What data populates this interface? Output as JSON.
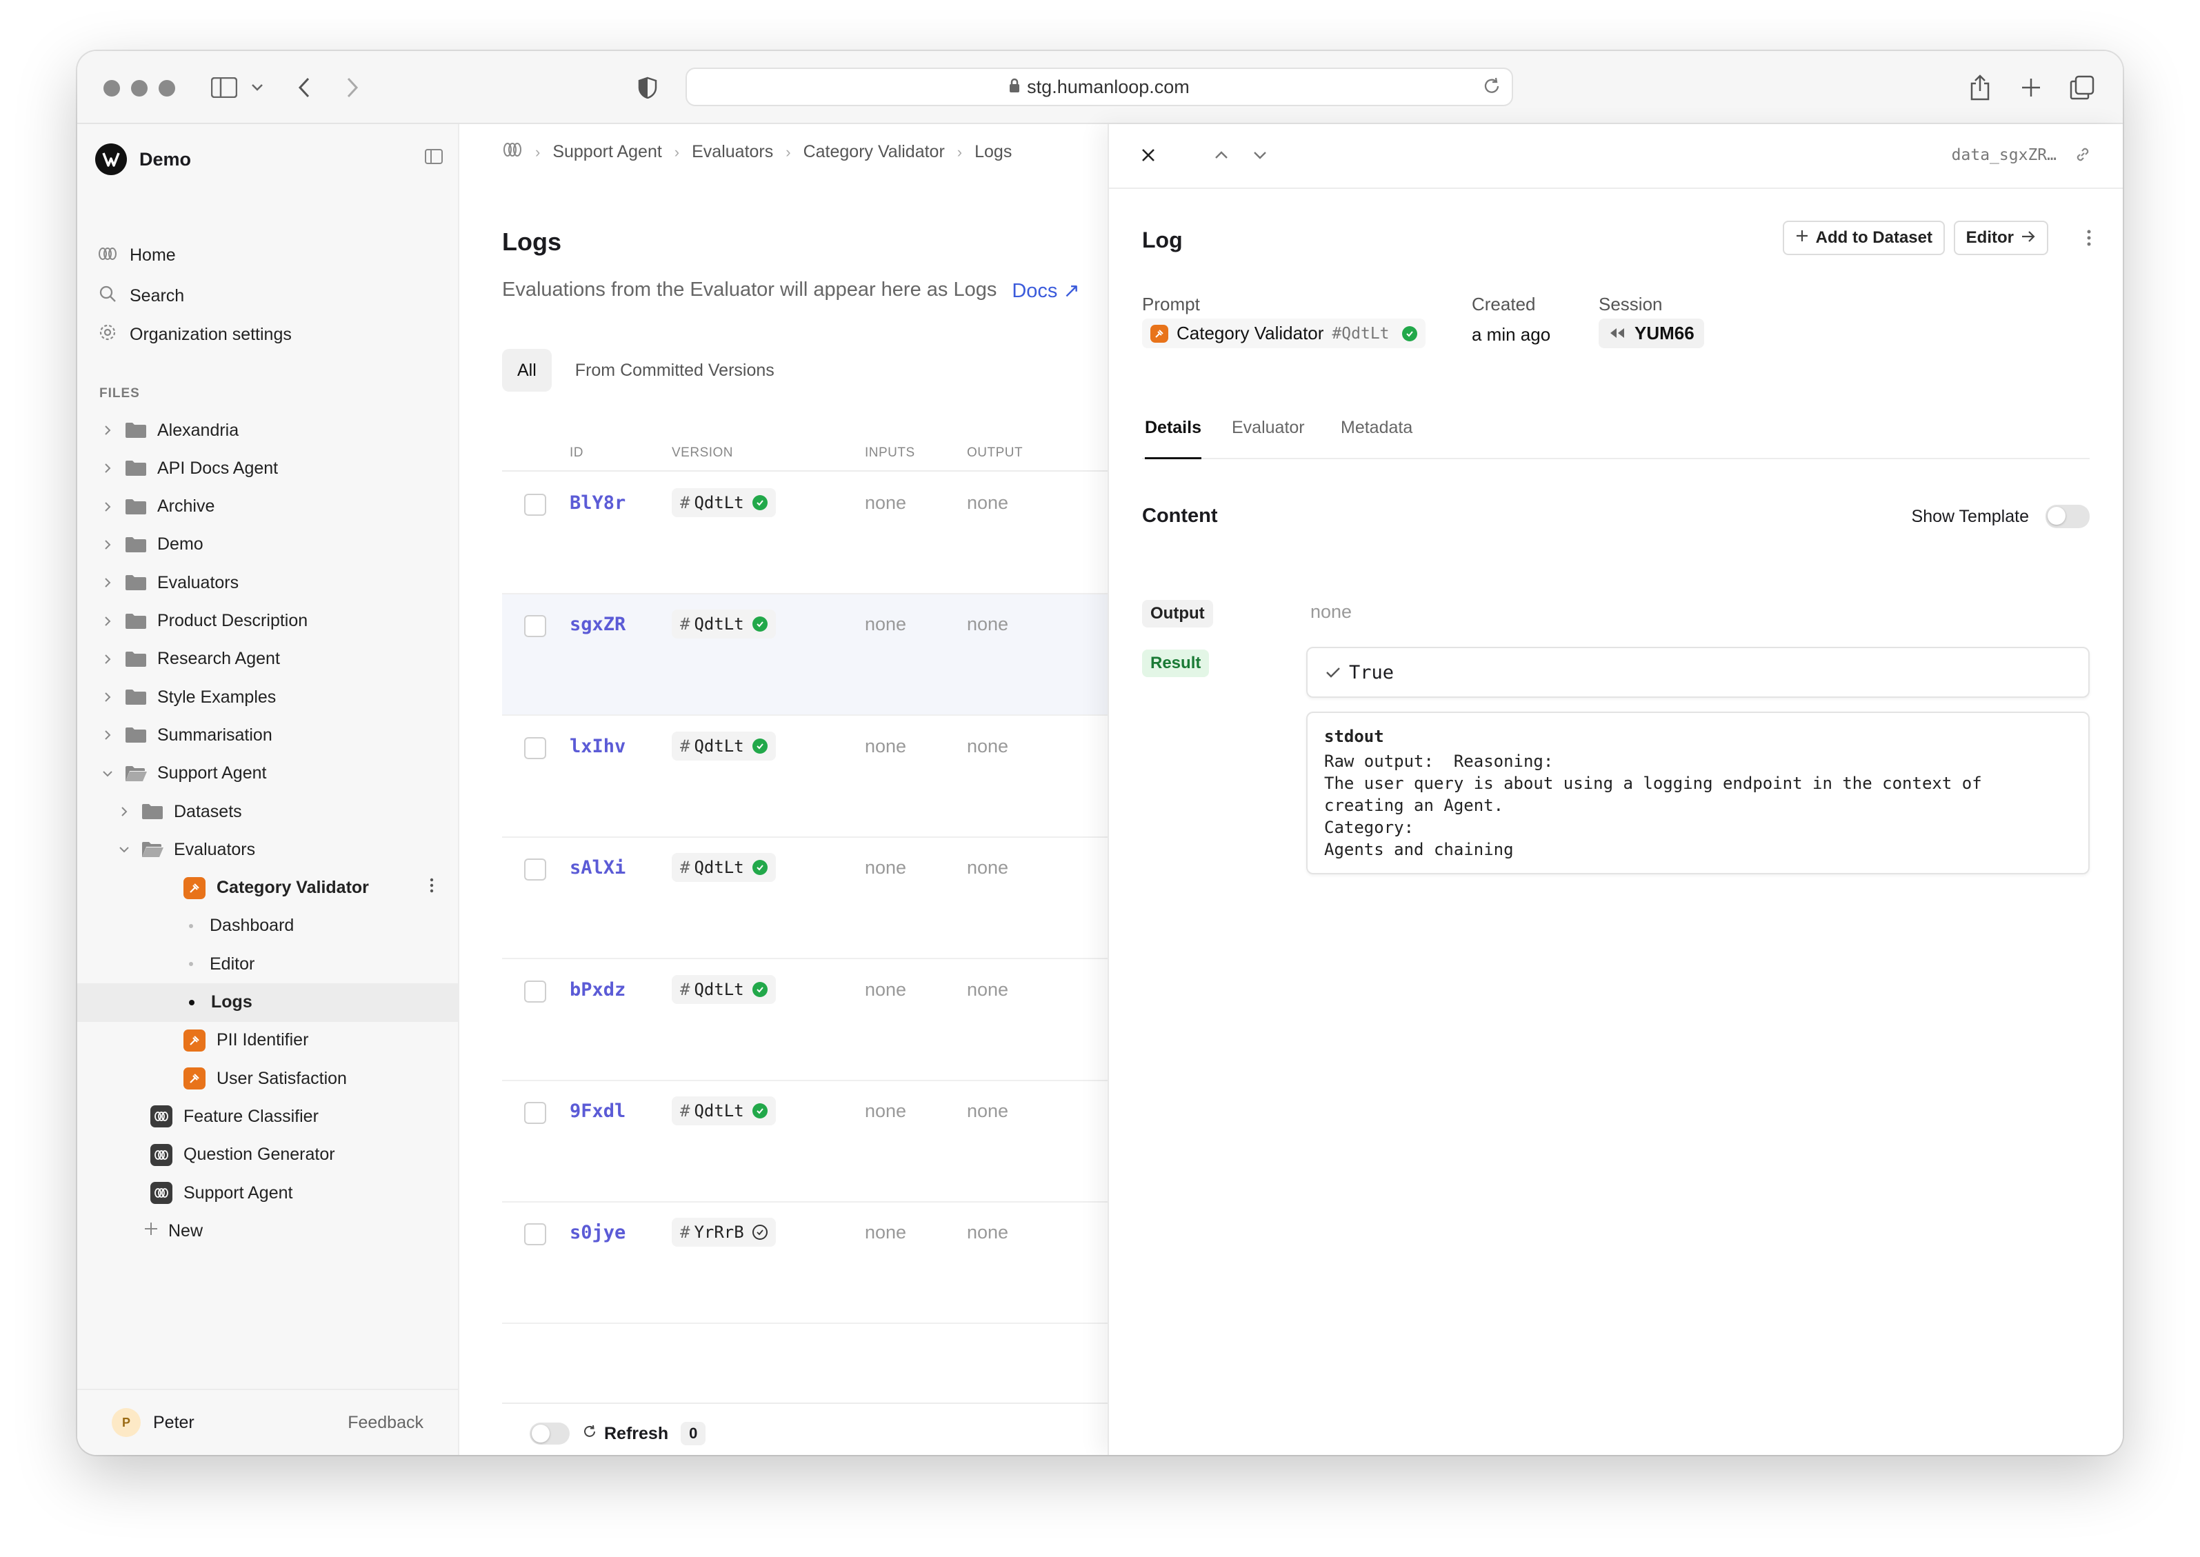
{
  "browser": {
    "url": "stg.humanloop.com"
  },
  "sidebar": {
    "org_name": "Demo",
    "nav": [
      {
        "label": "Home",
        "icon": "humanloop-icon"
      },
      {
        "label": "Search",
        "icon": "search-icon"
      },
      {
        "label": "Organization settings",
        "icon": "gear-icon"
      }
    ],
    "files_label": "FILES",
    "tree": [
      {
        "label": "Alexandria",
        "type": "folder"
      },
      {
        "label": "API Docs Agent",
        "type": "folder"
      },
      {
        "label": "Archive",
        "type": "folder"
      },
      {
        "label": "Demo",
        "type": "folder"
      },
      {
        "label": "Evaluators",
        "type": "folder"
      },
      {
        "label": "Product Description",
        "type": "folder"
      },
      {
        "label": "Research Agent",
        "type": "folder"
      },
      {
        "label": "Style Examples",
        "type": "folder"
      },
      {
        "label": "Summarisation",
        "type": "folder"
      },
      {
        "label": "Support Agent",
        "type": "folder-open"
      },
      {
        "label": "Datasets",
        "type": "folder"
      },
      {
        "label": "Evaluators",
        "type": "folder-open"
      },
      {
        "label": "Category Validator",
        "type": "prompt"
      },
      {
        "label": "Dashboard",
        "type": "sub"
      },
      {
        "label": "Editor",
        "type": "sub"
      },
      {
        "label": "Logs",
        "type": "sub-active"
      },
      {
        "label": "PII Identifier",
        "type": "prompt"
      },
      {
        "label": "User Satisfaction",
        "type": "prompt"
      },
      {
        "label": "Feature Classifier",
        "type": "agent"
      },
      {
        "label": "Question Generator",
        "type": "agent"
      },
      {
        "label": "Support Agent",
        "type": "agent"
      },
      {
        "label": "New",
        "type": "new"
      }
    ],
    "user": {
      "initial": "P",
      "name": "Peter"
    },
    "feedback_label": "Feedback"
  },
  "main": {
    "breadcrumb": [
      "Support Agent",
      "Evaluators",
      "Category Validator",
      "Logs"
    ],
    "title": "Logs",
    "description": "Evaluations from the Evaluator will appear here as Logs",
    "docs_link": "Docs",
    "filter_tabs": [
      "All",
      "From Committed Versions"
    ],
    "columns": [
      "ID",
      "VERSION",
      "INPUTS",
      "OUTPUT"
    ],
    "rows": [
      {
        "id": "BlY8r",
        "version": "QdtLt",
        "status": "deployed",
        "inputs": "none",
        "output": "none"
      },
      {
        "id": "sgxZR",
        "version": "QdtLt",
        "status": "deployed",
        "inputs": "none",
        "output": "none"
      },
      {
        "id": "lxIhv",
        "version": "QdtLt",
        "status": "deployed",
        "inputs": "none",
        "output": "none"
      },
      {
        "id": "sAlXi",
        "version": "QdtLt",
        "status": "deployed",
        "inputs": "none",
        "output": "none"
      },
      {
        "id": "bPxdz",
        "version": "QdtLt",
        "status": "deployed",
        "inputs": "none",
        "output": "none"
      },
      {
        "id": "9Fxdl",
        "version": "QdtLt",
        "status": "deployed",
        "inputs": "none",
        "output": "none"
      },
      {
        "id": "s0jye",
        "version": "YrRrB",
        "status": "pending",
        "inputs": "none",
        "output": "none"
      }
    ],
    "refresh_label": "Refresh",
    "refresh_count": "0"
  },
  "panel": {
    "data_id": "data_sgxZR…",
    "title": "Log",
    "add_to_dataset": "Add to Dataset",
    "editor": "Editor",
    "prompt_label": "Prompt",
    "prompt_name": "Category Validator",
    "prompt_version": "QdtLt",
    "created_label": "Created",
    "created_value": "a min ago",
    "session_label": "Session",
    "session_value": "YUM66",
    "tabs": [
      "Details",
      "Evaluator",
      "Metadata"
    ],
    "content_title": "Content",
    "show_template": "Show Template",
    "output_label": "Output",
    "output_value": "none",
    "result_label": "Result",
    "result_value": "True",
    "stdout_title": "stdout",
    "stdout_text": "Raw output:  Reasoning:\nThe user query is about using a logging endpoint in the context of\ncreating an Agent.\nCategory:\nAgents and chaining"
  },
  "colors": {
    "accent_link": "#3b5bdb",
    "id_link": "#5b5bd6",
    "prompt_orange": "#e8731a",
    "status_green": "#22a84a"
  }
}
